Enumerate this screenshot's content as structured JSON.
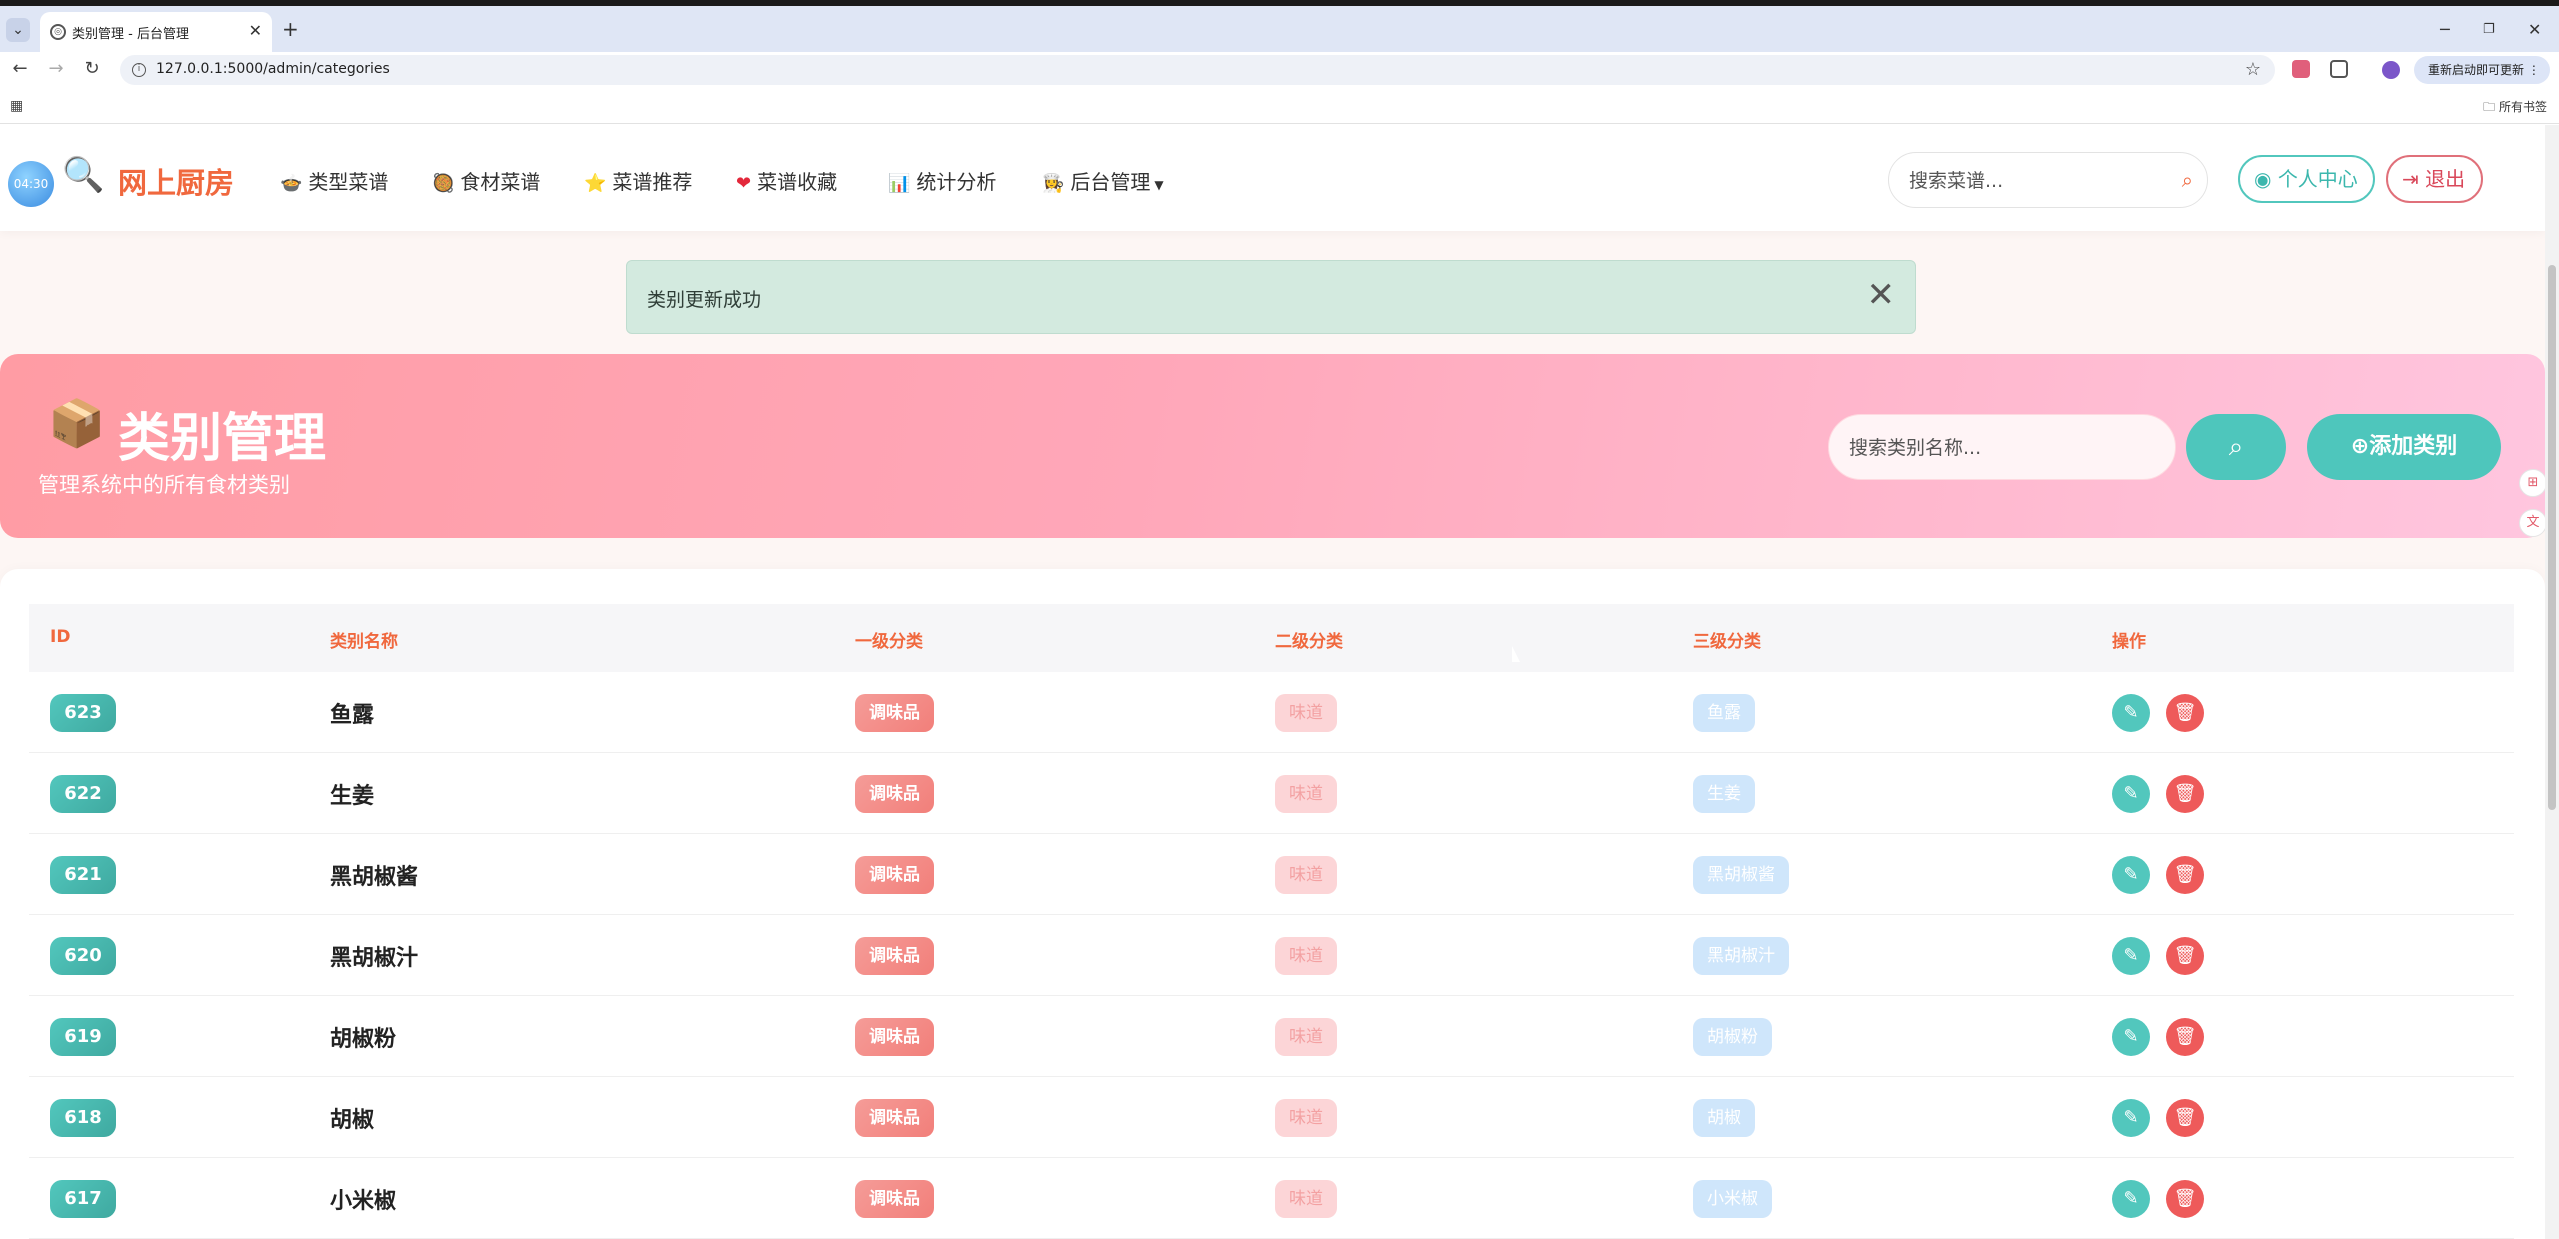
{
  "browser": {
    "tab_title": "类别管理 - 后台管理",
    "url": "127.0.0.1:5000/admin/categories",
    "update_label": "重新启动即可更新",
    "all_bookmarks": "所有书签"
  },
  "navbar": {
    "clock": "04:30",
    "brand": "网上厨房",
    "items": [
      {
        "icon": "🍲",
        "label": "类型菜谱"
      },
      {
        "icon": "🥘",
        "label": "食材菜谱"
      },
      {
        "icon": "⭐",
        "label": "菜谱推荐"
      },
      {
        "icon": "❤",
        "label": "菜谱收藏"
      },
      {
        "icon": "📊",
        "label": "统计分析"
      },
      {
        "icon": "👩‍🍳",
        "label": "后台管理"
      }
    ],
    "search_placeholder": "搜索菜谱...",
    "profile_label": "个人中心",
    "logout_label": "退出"
  },
  "alert": {
    "message": "类别更新成功"
  },
  "hero": {
    "title": "类别管理",
    "subtitle": "管理系统中的所有食材类别",
    "search_placeholder": "搜索类别名称...",
    "add_label": "添加类别"
  },
  "table": {
    "headers": [
      "ID",
      "类别名称",
      "一级分类",
      "二级分类",
      "三级分类",
      "操作"
    ],
    "rows": [
      {
        "id": "623",
        "name": "鱼露",
        "l1": "调味品",
        "l2": "味道",
        "l3": "鱼露"
      },
      {
        "id": "622",
        "name": "生姜",
        "l1": "调味品",
        "l2": "味道",
        "l3": "生姜"
      },
      {
        "id": "621",
        "name": "黑胡椒酱",
        "l1": "调味品",
        "l2": "味道",
        "l3": "黑胡椒酱"
      },
      {
        "id": "620",
        "name": "黑胡椒汁",
        "l1": "调味品",
        "l2": "味道",
        "l3": "黑胡椒汁"
      },
      {
        "id": "619",
        "name": "胡椒粉",
        "l1": "调味品",
        "l2": "味道",
        "l3": "胡椒粉"
      },
      {
        "id": "618",
        "name": "胡椒",
        "l1": "调味品",
        "l2": "味道",
        "l3": "胡椒"
      },
      {
        "id": "617",
        "name": "小米椒",
        "l1": "调味品",
        "l2": "味道",
        "l3": "小米椒"
      }
    ]
  },
  "colors": {
    "accent_orange": "#f0683e",
    "teal": "#4ec6bc",
    "danger": "#ee5a5a",
    "hero_pink": "#ffa7b9",
    "alert_green": "#d3eadf"
  }
}
